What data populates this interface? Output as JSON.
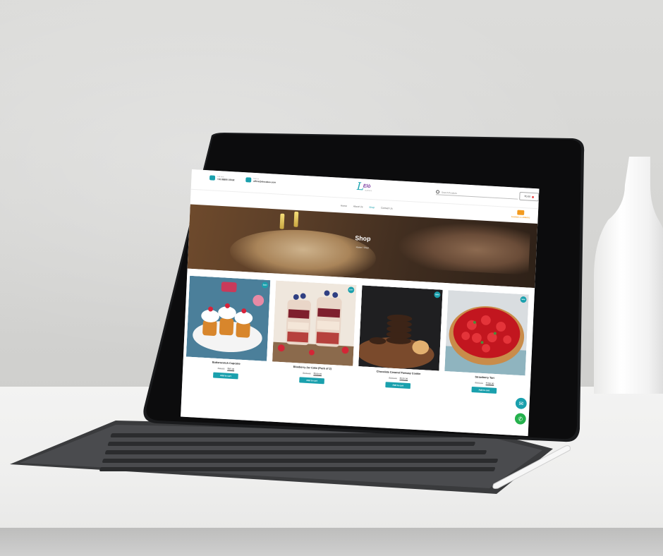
{
  "site": {
    "contact_phone_label": "Call Now",
    "contact_phone": "+91 88890 15532",
    "contact_email_label": "Mail Us",
    "contact_email": "office@elocakes.com",
    "logo_letter": "L",
    "logo_name": "Elò",
    "logo_sub": "CAKES",
    "search_placeholder": "Search Products",
    "cart_amount": "₹0.00",
    "nav": [
      "Home",
      "About Us",
      "Shop",
      "Contact Us"
    ],
    "nav_active": "Shop",
    "delivery_text": "Available on ZOMATO",
    "hero_title": "Shop",
    "breadcrumb": "Home / Shop"
  },
  "products": [
    {
      "name": "Butterscotch Cupcake",
      "old_price": "₹99.00",
      "new_price": "₹95.00",
      "sale_badge": "Sale!",
      "button": "Add to cart",
      "image": "cupcakes"
    },
    {
      "name": "Blueberry Jar Cake (Pack of 2)",
      "old_price": "₹649.00",
      "new_price": "₹600.00",
      "sale_badge": "Sale!",
      "button": "Add to cart",
      "image": "jar-cakes"
    },
    {
      "name": "Chocolate Caramel Fantasy Cookie",
      "old_price": "₹600.00",
      "new_price": "₹525.00",
      "sale_badge": "Sale!",
      "button": "Add to cart",
      "image": "cookies"
    },
    {
      "name": "Strawberry Tart",
      "old_price": "₹880.00",
      "new_price": "₹799.00",
      "sale_badge": "Sale!",
      "button": "Add to cart",
      "image": "strawberry-tart"
    }
  ],
  "floating": {
    "mail_icon": "mail-icon",
    "whatsapp_icon": "whatsapp-icon"
  },
  "colors": {
    "accent": "#1aa0ad",
    "delivery": "#f39a1e",
    "logo_purple": "#7a3ea0"
  }
}
